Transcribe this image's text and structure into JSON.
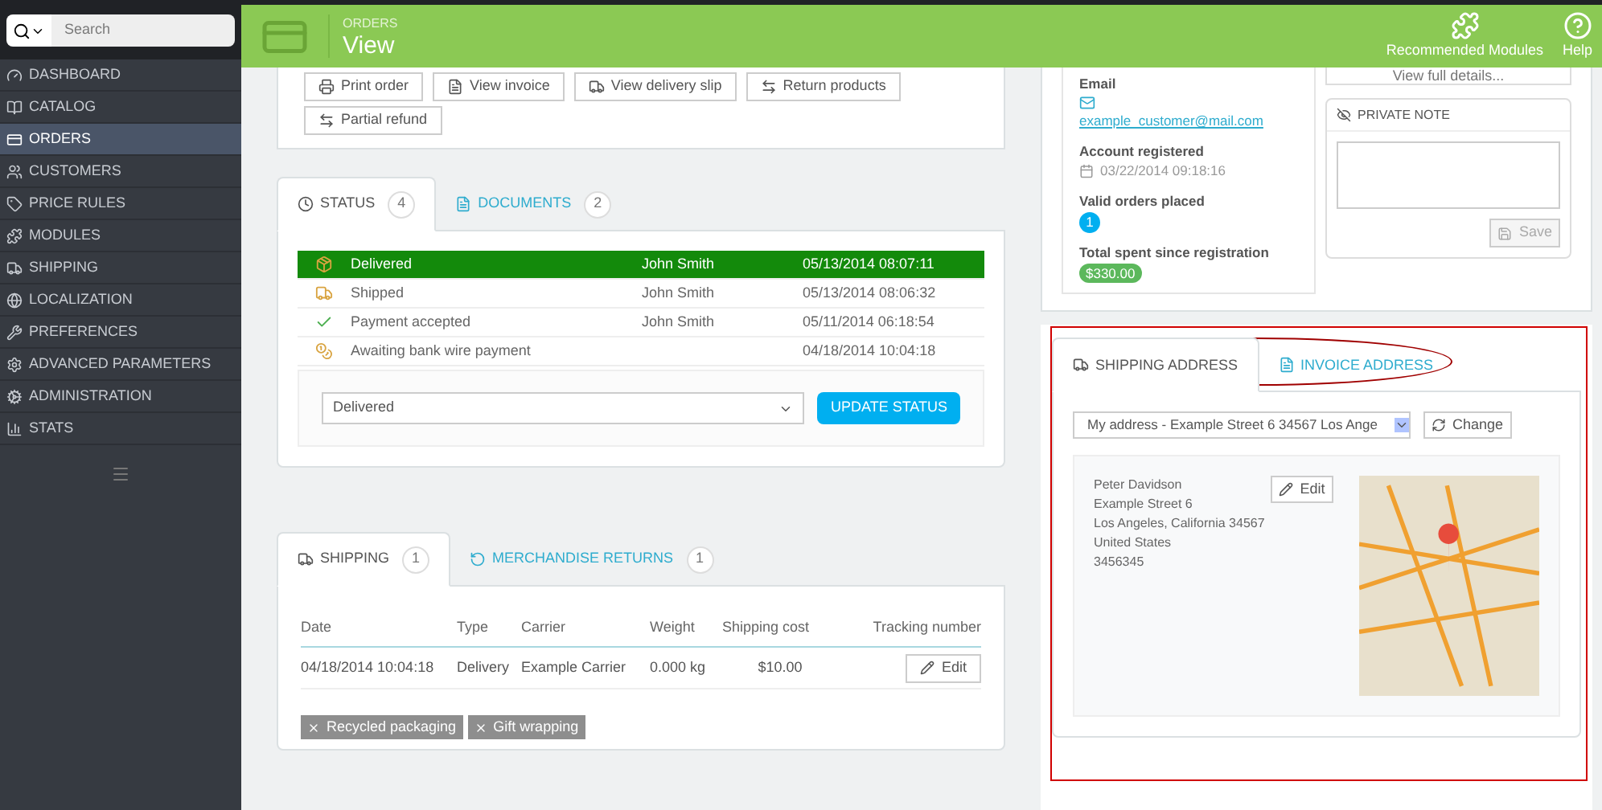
{
  "search": {
    "placeholder": "Search"
  },
  "sidebar": {
    "items": [
      {
        "label": "DASHBOARD",
        "selected": false
      },
      {
        "label": "CATALOG",
        "selected": false
      },
      {
        "label": "ORDERS",
        "selected": true
      },
      {
        "label": "CUSTOMERS",
        "selected": false
      },
      {
        "label": "PRICE RULES",
        "selected": false
      },
      {
        "label": "MODULES",
        "selected": false
      },
      {
        "label": "SHIPPING",
        "selected": false
      },
      {
        "label": "LOCALIZATION",
        "selected": false
      },
      {
        "label": "PREFERENCES",
        "selected": false
      },
      {
        "label": "ADVANCED PARAMETERS",
        "selected": false
      },
      {
        "label": "ADMINISTRATION",
        "selected": false
      },
      {
        "label": "STATS",
        "selected": false
      }
    ]
  },
  "header": {
    "breadcrumb": "ORDERS",
    "title": "View",
    "actions": [
      "Recommended Modules",
      "Help"
    ]
  },
  "order_actions": [
    "Print order",
    "View invoice",
    "View delivery slip",
    "Return products",
    "Partial refund"
  ],
  "status_tabs": [
    {
      "label": "STATUS",
      "count": "4",
      "selected": true
    },
    {
      "label": "DOCUMENTS",
      "count": "2",
      "selected": false
    }
  ],
  "status_history": [
    {
      "status": "Delivered",
      "employee": "John Smith",
      "date": "05/13/2014 08:07:11",
      "selected": true
    },
    {
      "status": "Shipped",
      "employee": "John Smith",
      "date": "05/13/2014 08:06:32",
      "selected": false
    },
    {
      "status": "Payment accepted",
      "employee": "John Smith",
      "date": "05/11/2014 06:18:54",
      "selected": false
    },
    {
      "status": "Awaiting bank wire payment",
      "date": "04/18/2014 10:04:18",
      "selected": false
    }
  ],
  "status_select": {
    "value": "Delivered"
  },
  "update_status_button": "UPDATE STATUS",
  "shipping_tabs": [
    {
      "label": "SHIPPING",
      "count": "1",
      "selected": true
    },
    {
      "label": "MERCHANDISE RETURNS",
      "count": "1",
      "selected": false
    }
  ],
  "shipping_table": {
    "columns": [
      "Date",
      "Type",
      "Carrier",
      "Weight",
      "Shipping cost",
      "Tracking number"
    ],
    "rows": [
      {
        "cells": [
          "04/18/2014 10:04:18",
          "Delivery",
          "Example Carrier",
          "0.000 kg",
          "$10.00"
        ],
        "action": "Edit"
      }
    ]
  },
  "shipping_tags": [
    "Recycled packaging",
    "Gift wrapping"
  ],
  "customer": {
    "email_label": "Email",
    "email": "example_customer@mail.com",
    "registered_label": "Account registered",
    "registered": "03/22/2014 09:18:16",
    "orders_label": "Valid orders placed",
    "orders": "1",
    "spent_label": "Total spent since registration",
    "spent": "$330.00",
    "details_button": "View full details..."
  },
  "private_note": {
    "title": "PRIVATE NOTE",
    "save": "Save"
  },
  "address_tabs": [
    {
      "label": "SHIPPING ADDRESS",
      "selected": true
    },
    {
      "label": "INVOICE ADDRESS",
      "selected": false
    }
  ],
  "address_select": {
    "value": "My address - Example Street 6 34567 Los Ange"
  },
  "change_button": "Change",
  "address": {
    "lines": [
      "Peter Davidson",
      "Example Street 6",
      "Los Angeles, California 34567",
      "United States",
      "3456345"
    ],
    "edit": "Edit"
  }
}
